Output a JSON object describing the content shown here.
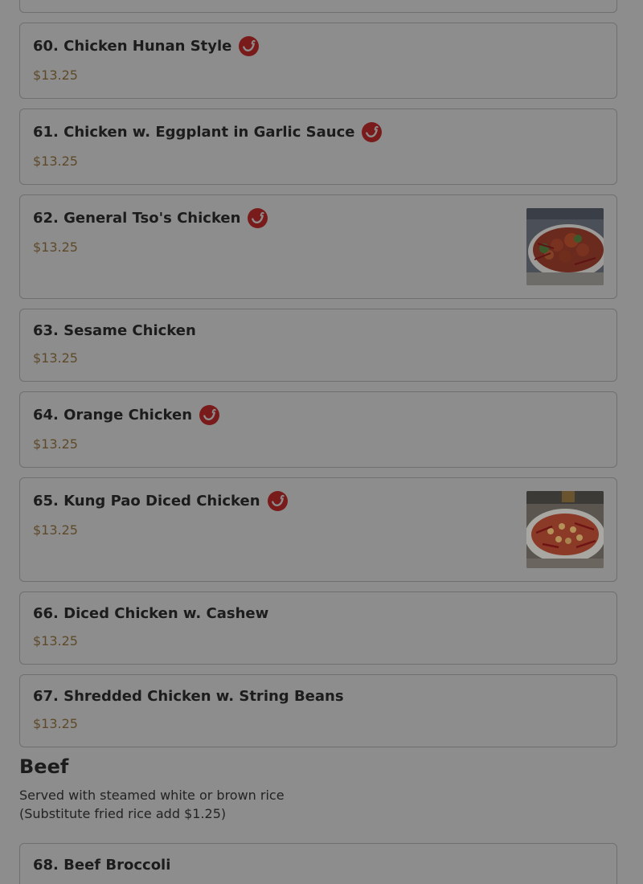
{
  "menu": {
    "items": [
      {
        "name": "60. Chicken Hunan Style",
        "price": "$13.25",
        "spicy": true,
        "photo": false
      },
      {
        "name": "61. Chicken w. Eggplant in Garlic Sauce",
        "price": "$13.25",
        "spicy": true,
        "photo": false
      },
      {
        "name": "62. General Tso's Chicken",
        "price": "$13.25",
        "spicy": true,
        "photo": true
      },
      {
        "name": "63. Sesame Chicken",
        "price": "$13.25",
        "spicy": false,
        "photo": false
      },
      {
        "name": "64. Orange Chicken",
        "price": "$13.25",
        "spicy": true,
        "photo": false
      },
      {
        "name": "65. Kung Pao Diced Chicken",
        "price": "$13.25",
        "spicy": true,
        "photo": true
      },
      {
        "name": "66. Diced Chicken w. Cashew",
        "price": "$13.25",
        "spicy": false,
        "photo": false
      },
      {
        "name": "67. Shredded Chicken w. String Beans",
        "price": "$13.25",
        "spicy": false,
        "photo": false
      },
      {
        "name": "68. Beef Broccoli",
        "price": "",
        "spicy": false,
        "photo": false
      }
    ]
  },
  "beef_section": {
    "title": "Beef",
    "desc_line1": "Served with steamed white or brown rice",
    "desc_line2": "(Substitute fried rice add $1.25)"
  },
  "colors": {
    "overlay_bg": "#8d8d8d",
    "spicy_badge": "#7a1b1b",
    "price_text": "#5e4a2a"
  },
  "icons": {
    "spicy": "chili-pepper-icon"
  }
}
